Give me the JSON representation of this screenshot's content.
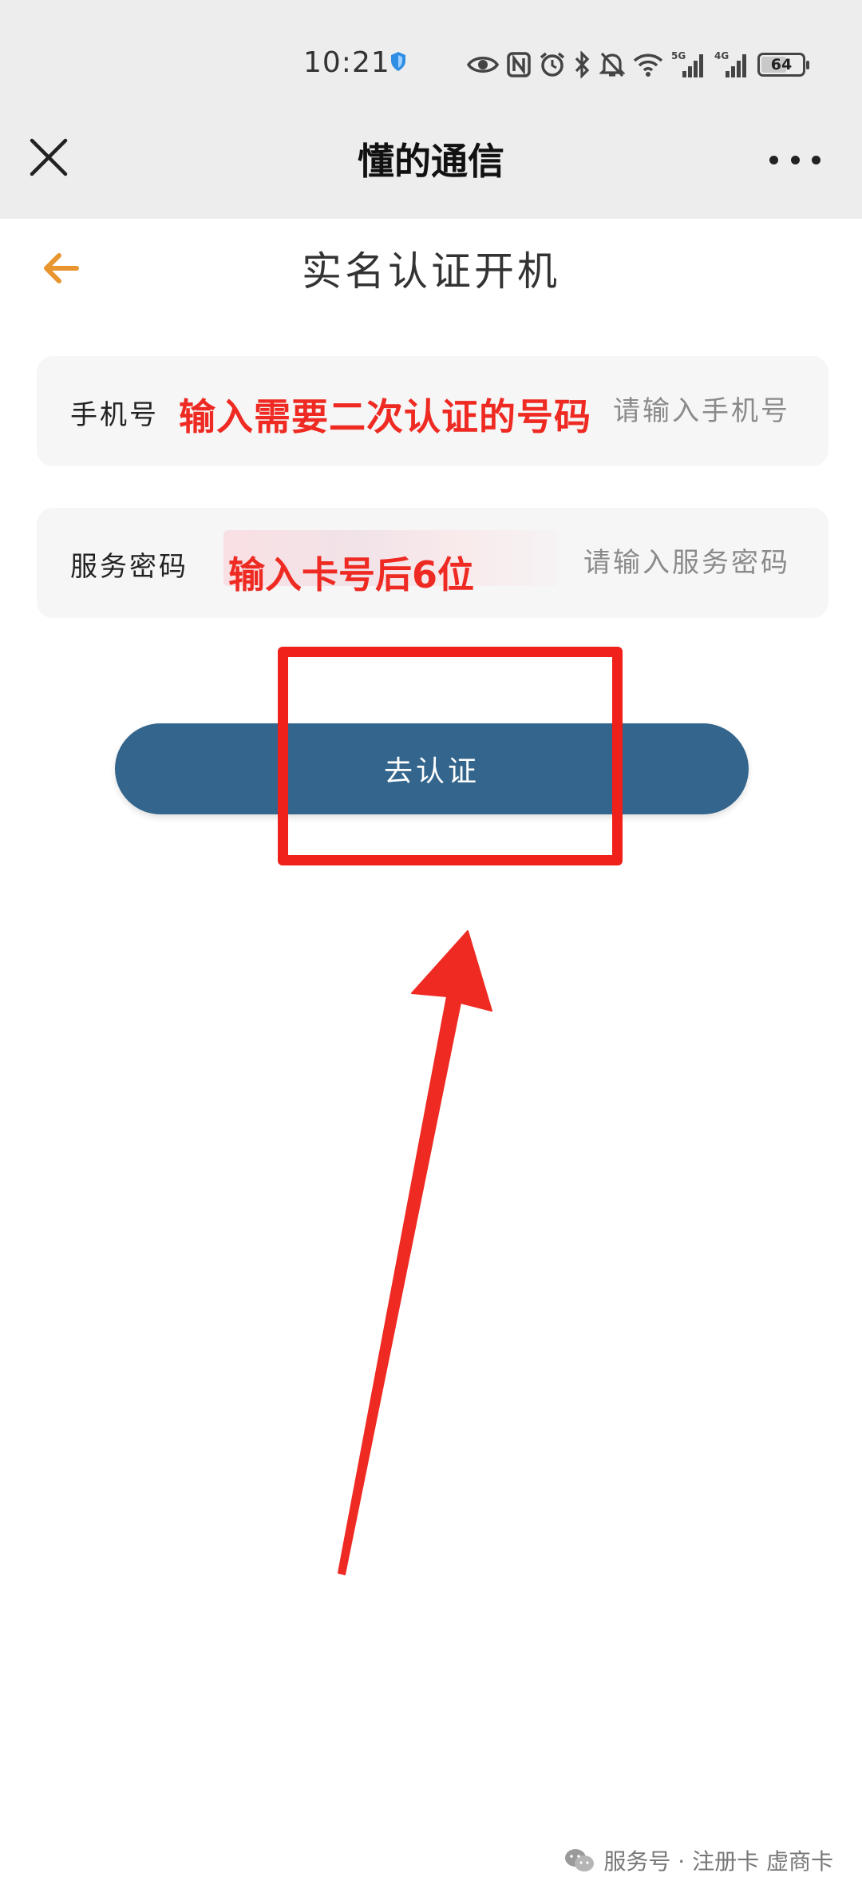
{
  "status_bar": {
    "time": "10:21",
    "battery": "64",
    "network_5g": "5G",
    "network_4g": "4G",
    "battery_level_percent": 64
  },
  "header": {
    "title": "懂的通信",
    "close_icon": "close-icon",
    "more_icon": "more-horizontal-icon"
  },
  "page": {
    "title": "实名认证开机",
    "back_icon": "arrow-left-icon",
    "accent_color": "#e8952f"
  },
  "form": {
    "phone": {
      "label": "手机号",
      "placeholder": "请输入手机号",
      "value": ""
    },
    "password": {
      "label": "服务密码",
      "placeholder": "请输入服务密码",
      "value": ""
    },
    "submit_label": "去认证",
    "button_color": "#33658d"
  },
  "annotations": {
    "phone_hint": "输入需要二次认证的号码",
    "password_hint": "输入卡号后6位",
    "color": "#ee2a22"
  },
  "footer": {
    "watermark": "服务号 · 注册卡 虚商卡"
  }
}
